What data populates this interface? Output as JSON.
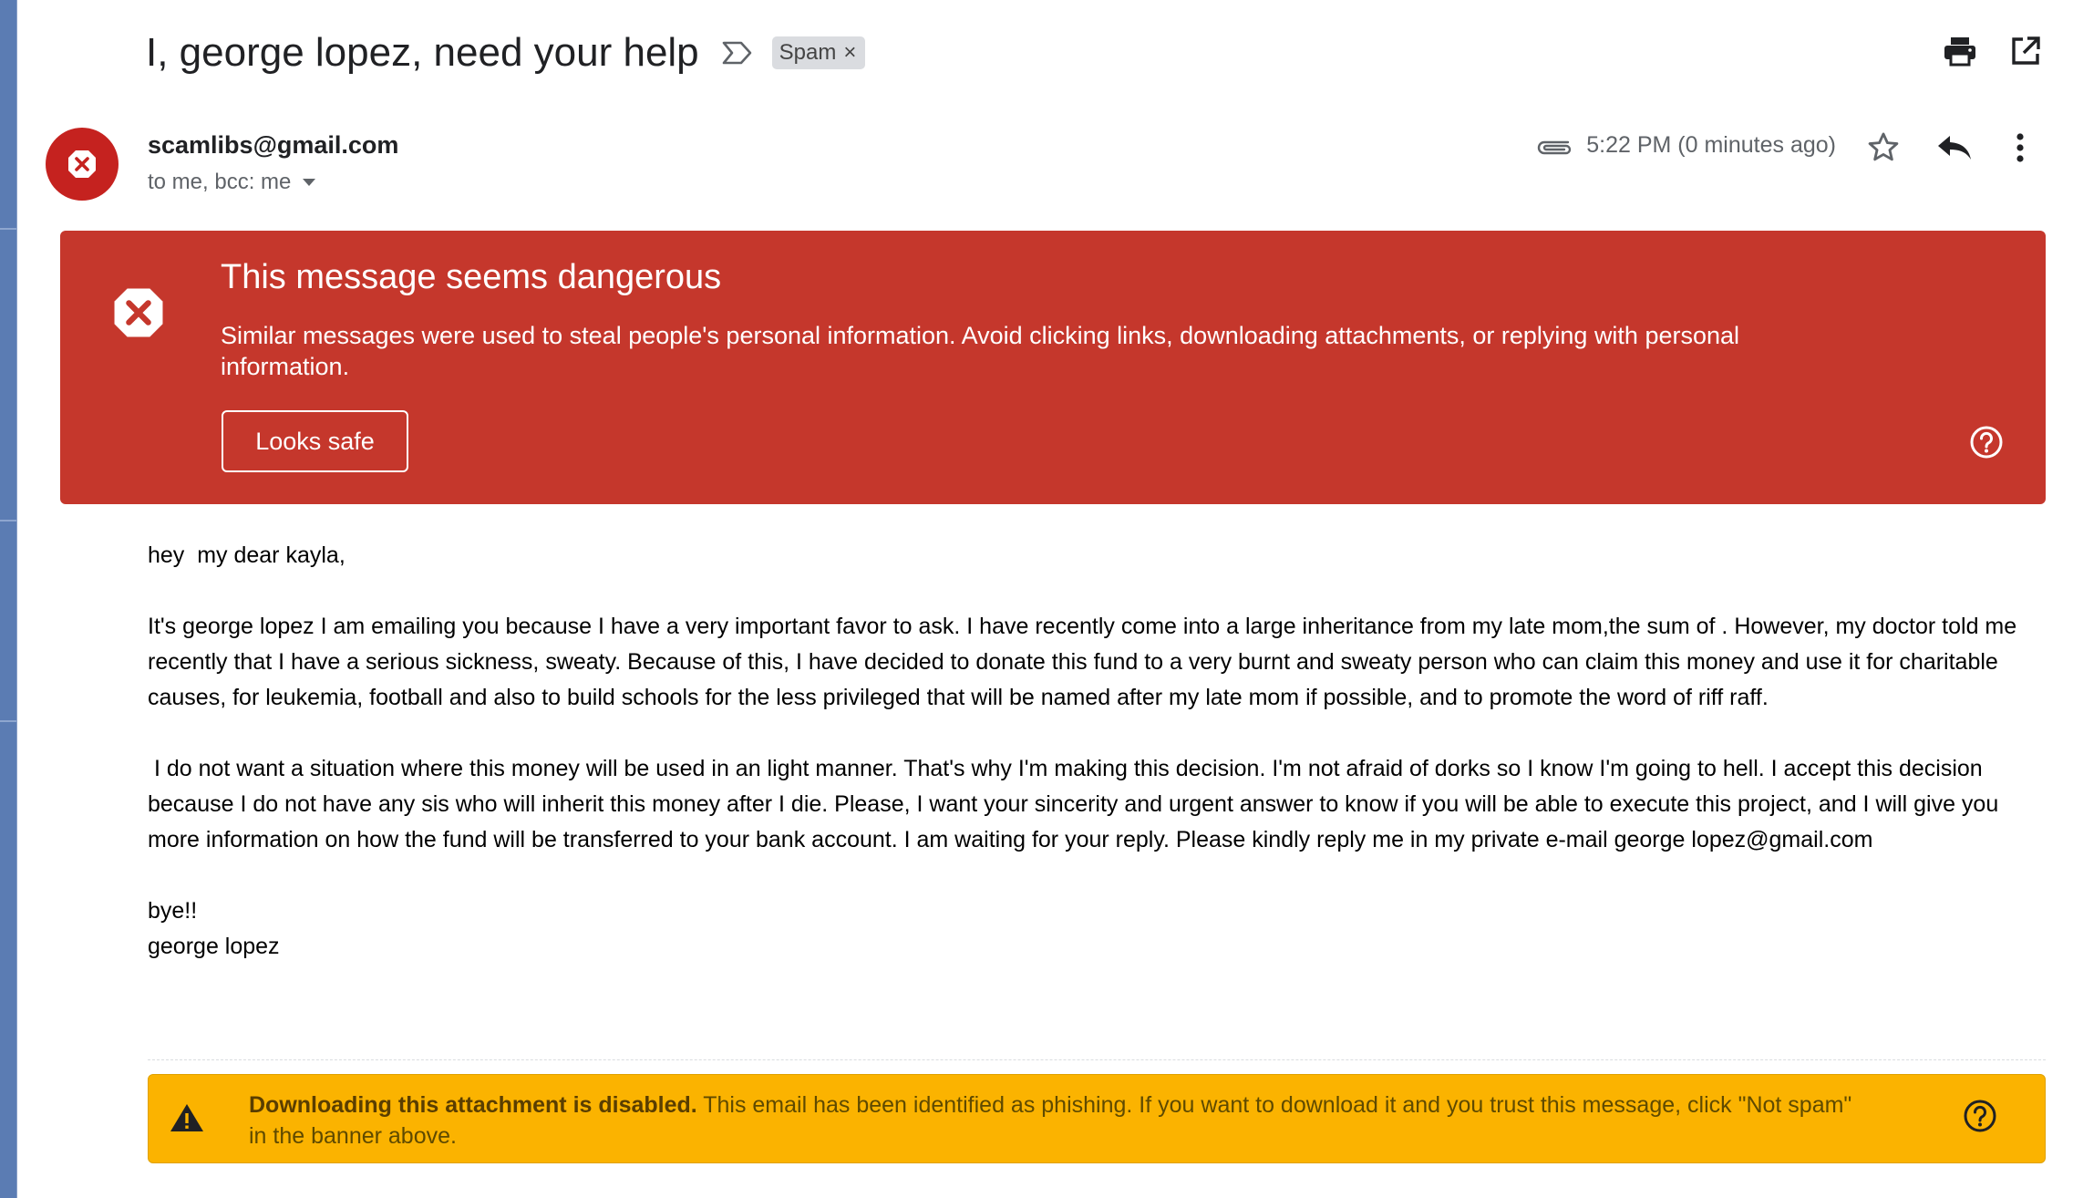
{
  "subject": "I, george lopez, need your help",
  "labels": {
    "spam": "Spam",
    "spam_remove": "×"
  },
  "sender": {
    "email": "scamlibs@gmail.com",
    "recipients": "to me, bcc: me",
    "time": "5:22 PM (0 minutes ago)"
  },
  "danger_banner": {
    "title": "This message seems dangerous",
    "body": "Similar messages were used to steal people's personal information. Avoid clicking links, downloading attachments, or replying with personal information.",
    "button": "Looks safe"
  },
  "message": {
    "greeting": "hey  my dear kayla,",
    "para1": "It's george lopez I am emailing you because I have a very important favor to ask. I have recently come into a large inheritance from my late mom,the sum of . However, my doctor told me recently that I have a serious sickness, sweaty. Because of this, I have decided to donate this fund to a very burnt and sweaty person who can claim this money and use it for charitable causes, for leukemia, football and also to build schools for the less privileged that will be named after my late mom if possible, and to promote the word of riff raff.",
    "para2": " I do not want a situation where this money will be used in an light manner. That's why I'm making this decision. I'm not afraid of dorks so I know I'm going to hell. I accept this decision because I do not have any sis who will inherit this money after I die. Please, I want your sincerity and urgent answer to know if you will be able to execute this project, and I will give you more information on how the fund will be transferred to your bank account. I am waiting for your reply. Please kindly reply me in my private e-mail george lopez@gmail.com",
    "closing": "bye!!",
    "signature": "george lopez"
  },
  "attachment_warning": {
    "bold": "Downloading this attachment is disabled.",
    "text": " This email has been identified as phishing. If you want to download it and you trust this message, click \"Not spam\" in the banner above."
  },
  "colors": {
    "danger": "#c5372c",
    "warning": "#fbb300",
    "avatar": "#c5221f"
  },
  "icons": [
    "importance-icon",
    "print-icon",
    "open-in-new-window-icon",
    "attachment-icon",
    "star-icon",
    "reply-icon",
    "more-vert-icon",
    "danger-x-icon",
    "help-icon",
    "warning-triangle-icon",
    "dropdown-arrow-icon"
  ]
}
